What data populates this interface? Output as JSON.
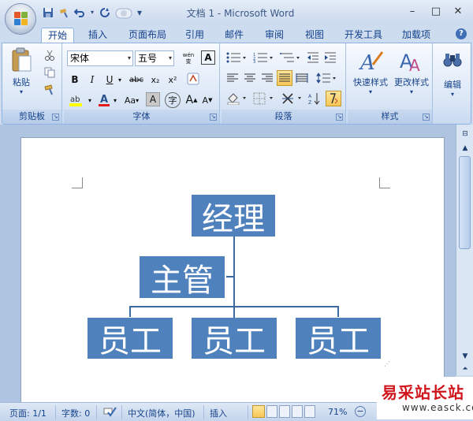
{
  "window": {
    "title": "文档 1 - Microsoft Word",
    "min": "–",
    "max": "□",
    "close": "✕"
  },
  "quick_access": {
    "customize": "▾"
  },
  "tabs": [
    {
      "label": "开始",
      "active": true
    },
    {
      "label": "插入"
    },
    {
      "label": "页面布局"
    },
    {
      "label": "引用"
    },
    {
      "label": "邮件"
    },
    {
      "label": "审阅"
    },
    {
      "label": "视图"
    },
    {
      "label": "开发工具"
    },
    {
      "label": "加载项"
    }
  ],
  "help": "?",
  "clipboard": {
    "label": "剪贴板",
    "paste": "粘贴"
  },
  "font": {
    "label": "字体",
    "name": "宋体",
    "size": "五号",
    "wen": "wén\n变",
    "bold": "B",
    "italic": "I",
    "underline": "U",
    "strike": "abc",
    "sub": "x₂",
    "sup": "x²",
    "change_case": "Aa",
    "char_shade": "A",
    "enclose": "字",
    "grow": "A",
    "shrink": "A"
  },
  "paragraph": {
    "label": "段落"
  },
  "styles": {
    "label": "样式",
    "quick_styles": "快速样式",
    "change_styles": "更改样式"
  },
  "editing": {
    "label": "编辑"
  },
  "org_chart": {
    "top": "经理",
    "assistant": "主管",
    "staff": [
      "员工",
      "员工",
      "员工"
    ]
  },
  "status": {
    "page": "页面: 1/1",
    "words": "字数: 0",
    "language": "中文(简体，中国)",
    "mode": "插入",
    "zoom": "71%"
  },
  "watermark": {
    "cn": "易采站长站",
    "en": "www.easck.com"
  },
  "colors": {
    "accent": "#4f81bd",
    "ribbon_border": "#8db2e3"
  }
}
